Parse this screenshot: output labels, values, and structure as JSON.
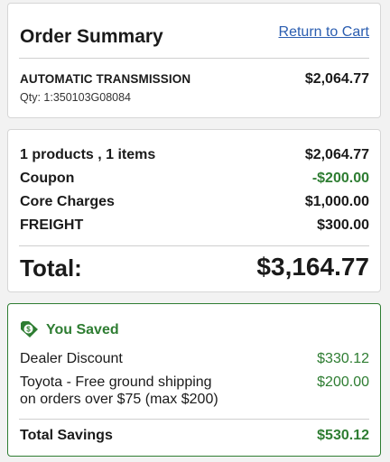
{
  "summary": {
    "title": "Order Summary",
    "return_link": "Return to Cart",
    "item": {
      "name": "AUTOMATIC TRANSMISSION",
      "qty": "Qty: 1:350103G08084",
      "price": "$2,064.77"
    }
  },
  "totals": {
    "rows": [
      {
        "label": "1 products , 1 items",
        "value": "$2,064.77"
      },
      {
        "label": "Coupon",
        "value": "-$200.00"
      },
      {
        "label": "Core Charges",
        "value": "$1,000.00"
      },
      {
        "label": "FREIGHT",
        "value": "$300.00"
      }
    ],
    "total_label": "Total:",
    "total_value": "$3,164.77"
  },
  "saved": {
    "title": "You Saved",
    "icon": "price-tag-icon",
    "items": [
      {
        "label": "Dealer Discount",
        "value": "$330.12"
      },
      {
        "label_line1": "Toyota - Free ground shipping",
        "label_line2": "on orders over $75 (max $200)",
        "value": "$200.00"
      }
    ],
    "total_label": "Total Savings",
    "total_value": "$530.12"
  },
  "colors": {
    "accent_green": "#2e7d32",
    "link_blue": "#2a5db0"
  }
}
